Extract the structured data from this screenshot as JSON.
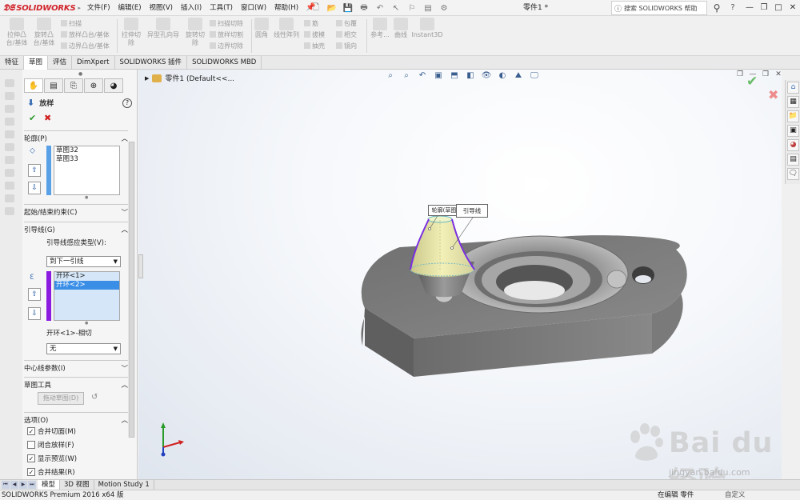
{
  "app": {
    "logo": "SOLIDWORKS",
    "doc_title": "零件1 *"
  },
  "menu": [
    "文件(F)",
    "编辑(E)",
    "视图(V)",
    "插入(I)",
    "工具(T)",
    "窗口(W)",
    "帮助(H)"
  ],
  "search": {
    "placeholder": "搜索 SOLIDWORKS 帮助"
  },
  "ribbon": {
    "extrude_boss": "拉伸凸\n台/基体",
    "revolve_boss": "旋转凸\n台/基体",
    "sweep": "扫描",
    "loft_boss": "放样凸台/基体",
    "boundary_boss": "边界凸台/基体",
    "extrude_cut": "拉伸切\n除",
    "hole_wizard": "异型孔向导",
    "revolve_cut": "旋转切\n除",
    "swept_cut": "扫描切除",
    "lofted_cut": "放样切割",
    "boundary_cut": "边界切除",
    "fillet": "圆角",
    "linear_pattern": "线性阵列",
    "rib": "筋",
    "draft": "拔模",
    "shell": "抽壳",
    "wrap": "包覆",
    "intersect": "相交",
    "mirror": "镜向",
    "reference": "参考...",
    "curves": "曲线",
    "instant3d": "Instant3D"
  },
  "cm_tabs": [
    "特征",
    "草图",
    "评估",
    "DimXpert",
    "SOLIDWORKS 插件",
    "SOLIDWORKS MBD"
  ],
  "property_manager": {
    "title": "放样",
    "profiles_header": "轮廓(P)",
    "profiles": [
      "草图32",
      "草图33"
    ],
    "start_end_header": "起始/结束约束(C)",
    "guides_header": "引导线(G)",
    "guide_influence_label": "引导线感应类型(V):",
    "guide_influence_value": "到下一引线",
    "guides": [
      "开环<1>",
      "开环<2>"
    ],
    "tangency_label": "开环<1>-相切",
    "tangency_value": "无",
    "centerline_header": "中心线参数(I)",
    "sketch_tools_header": "草图工具",
    "drag_sketch_button": "拖动草图(D)",
    "options_header": "选项(O)",
    "options": [
      {
        "label": "合并切面(M)",
        "checked": true
      },
      {
        "label": "闭合放样(F)",
        "checked": false
      },
      {
        "label": "显示预览(W)",
        "checked": true
      },
      {
        "label": "合并结果(R)",
        "checked": true
      }
    ]
  },
  "tree": {
    "root": "零件1 (Default<<..."
  },
  "callouts": {
    "profile": "轮廓(草图",
    "guide": "引导线"
  },
  "bottom_tabs": [
    "模型",
    "3D 视图",
    "Motion Study 1"
  ],
  "status": {
    "app_version": "SOLIDWORKS Premium 2016 x64 版",
    "editing": "在编辑 零件",
    "custom": "自定义"
  },
  "watermark": {
    "brand": "Bai du 经验",
    "url": "jingyan.baidu.com"
  },
  "colors": {
    "logo_red": "#d1232a",
    "selection_blue": "#3a8ee6",
    "profile_bar": "#5aa0e6",
    "guide_bar": "#8c1be0",
    "model_gray": "#7a7a7a",
    "guide_curve": "#7a2ee0",
    "loft_preview": "#e8e6a8"
  }
}
